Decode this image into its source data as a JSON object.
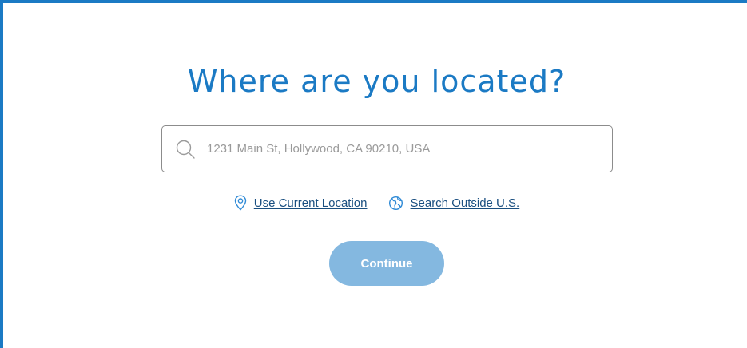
{
  "colors": {
    "accent": "#1b7ac4",
    "heading": "#1b7ac4",
    "link_text": "#1a4f80",
    "link_icon": "#2f8ad6",
    "button_bg": "#84b8e0",
    "button_text": "#ffffff"
  },
  "heading": "Where are you located?",
  "search": {
    "placeholder": "1231 Main St, Hollywood, CA 90210, USA",
    "value": "",
    "icon": "search-icon"
  },
  "links": {
    "current_location": {
      "label": "Use Current Location",
      "icon": "location-pin-icon"
    },
    "outside_us": {
      "label": "Search Outside U.S.",
      "icon": "globe-icon"
    }
  },
  "continue_button": {
    "label": "Continue",
    "state": "disabled"
  }
}
